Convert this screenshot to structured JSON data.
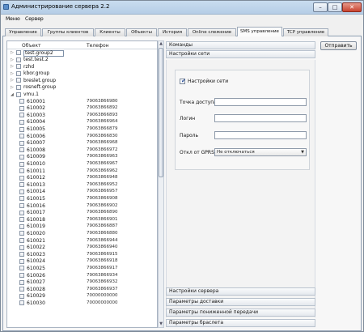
{
  "window": {
    "title": "Администрирование сервера 2.2",
    "controls": {
      "minimize": "–",
      "maximize": "□",
      "close": "✕"
    }
  },
  "menu": [
    "Меню",
    "Сервер"
  ],
  "tabs": [
    {
      "label": "Управление",
      "active": false
    },
    {
      "label": "Группы клиентов",
      "active": false
    },
    {
      "label": "Клиенты",
      "active": false
    },
    {
      "label": "Объекты",
      "active": false
    },
    {
      "label": "История",
      "active": false
    },
    {
      "label": "Online слежение",
      "active": false
    },
    {
      "label": "SMS управление",
      "active": true
    },
    {
      "label": "TCP управление",
      "active": false
    }
  ],
  "tree": {
    "col_object": "Объект",
    "col_phone": "Телефон",
    "groups": [
      {
        "name": "test.group2",
        "expanded": false,
        "editing": true
      },
      {
        "name": "test.test.2",
        "expanded": false,
        "editing": false
      },
      {
        "name": "rzhd",
        "expanded": false,
        "editing": false
      },
      {
        "name": "kbor.group",
        "expanded": false,
        "editing": false
      },
      {
        "name": "breslet.group",
        "expanded": false,
        "editing": false
      },
      {
        "name": "rosneft.group",
        "expanded": false,
        "editing": false
      },
      {
        "name": "vmu.1",
        "expanded": true,
        "editing": false
      }
    ],
    "items": [
      {
        "id": "610001",
        "phone": "79063866980"
      },
      {
        "id": "610002",
        "phone": "79063866892"
      },
      {
        "id": "610003",
        "phone": "79063866893"
      },
      {
        "id": "610004",
        "phone": "79063866964"
      },
      {
        "id": "610005",
        "phone": "79063866879"
      },
      {
        "id": "610006",
        "phone": "79063866830"
      },
      {
        "id": "610007",
        "phone": "79063866968"
      },
      {
        "id": "610008",
        "phone": "79063866972"
      },
      {
        "id": "610009",
        "phone": "79063866963"
      },
      {
        "id": "610010",
        "phone": "79063866967"
      },
      {
        "id": "610011",
        "phone": "79063866962"
      },
      {
        "id": "610012",
        "phone": "79063866948"
      },
      {
        "id": "610013",
        "phone": "79063866952"
      },
      {
        "id": "610014",
        "phone": "79063866957"
      },
      {
        "id": "610015",
        "phone": "79063866908"
      },
      {
        "id": "610016",
        "phone": "79063866902"
      },
      {
        "id": "610017",
        "phone": "79063866890"
      },
      {
        "id": "610018",
        "phone": "79063866901"
      },
      {
        "id": "610019",
        "phone": "79063866887"
      },
      {
        "id": "610020",
        "phone": "79063866880"
      },
      {
        "id": "610021",
        "phone": "79063866944"
      },
      {
        "id": "610022",
        "phone": "79063866940"
      },
      {
        "id": "610023",
        "phone": "79063866915"
      },
      {
        "id": "610024",
        "phone": "79063866918"
      },
      {
        "id": "610025",
        "phone": "79063866917"
      },
      {
        "id": "610026",
        "phone": "79063866934"
      },
      {
        "id": "610027",
        "phone": "79063866932"
      },
      {
        "id": "610028",
        "phone": "79063866937"
      },
      {
        "id": "610029",
        "phone": "70000000000"
      },
      {
        "id": "610030",
        "phone": "70000000000"
      }
    ]
  },
  "right": {
    "send_button": "Отправить",
    "commands": "Команды",
    "net_settings": "Настройки сети",
    "net_enabled_label": "Настройки сети",
    "net_enabled": true,
    "fields": {
      "access_point": {
        "label": "Точка доступа",
        "value": ""
      },
      "login": {
        "label": "Логин",
        "value": ""
      },
      "password": {
        "label": "Пароль",
        "value": ""
      },
      "gprs": {
        "label": "Откл от GPRS",
        "value": "Не отключаться"
      }
    },
    "bottom_sections": [
      "Настройки сервера",
      "Параметры доставки",
      "Параметры пониженной передачи",
      "Параметры браслета"
    ]
  }
}
